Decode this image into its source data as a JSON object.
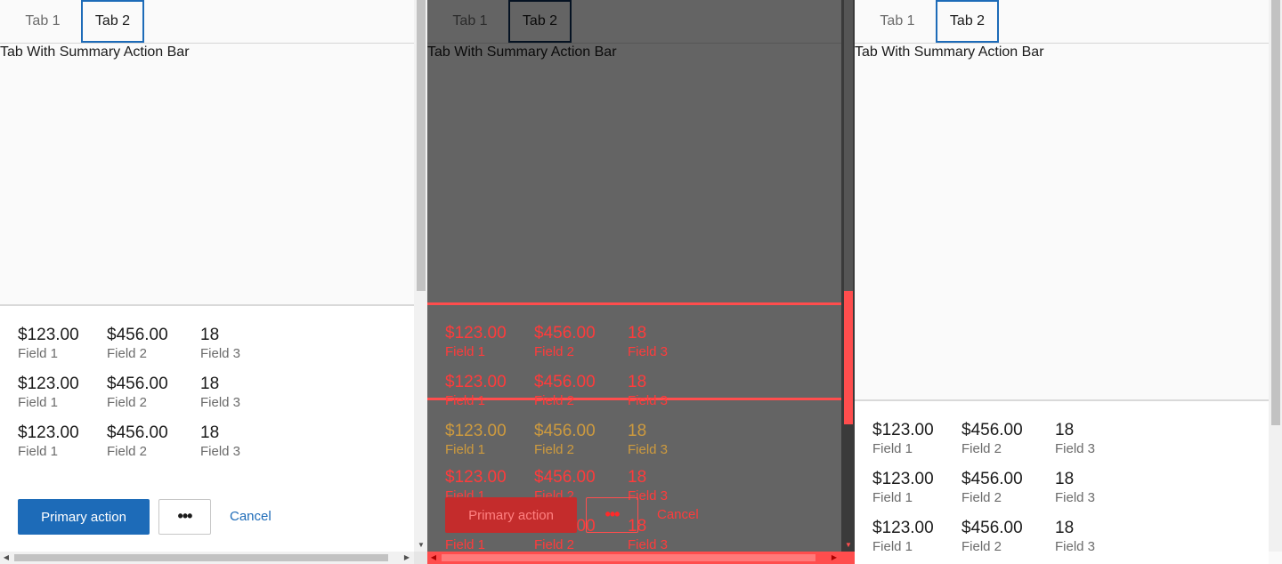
{
  "tabs": [
    {
      "label": "Tab 1"
    },
    {
      "label": "Tab 2"
    }
  ],
  "heading": "Tab With Summary Action Bar",
  "summary": {
    "rows": [
      {
        "field1_value": "$123.00",
        "field1_label": "Field 1",
        "field2_value": "$456.00",
        "field2_label": "Field 2",
        "field3_value": "18",
        "field3_label": "Field 3"
      },
      {
        "field1_value": "$123.00",
        "field1_label": "Field 1",
        "field2_value": "$456.00",
        "field2_label": "Field 2",
        "field3_value": "18",
        "field3_label": "Field 3"
      },
      {
        "field1_value": "$123.00",
        "field1_label": "Field 1",
        "field2_value": "$456.00",
        "field2_label": "Field 2",
        "field3_value": "18",
        "field3_label": "Field 3"
      }
    ]
  },
  "actions": {
    "primary_label": "Primary action",
    "more_label": "•••",
    "cancel_label": "Cancel"
  },
  "scroll": {
    "up_arrow": "▲",
    "down_arrow": "▼",
    "left_arrow": "◀",
    "right_arrow": "▶"
  },
  "colors": {
    "accent": "#1d6bb8",
    "highlight": "#ff4d4d",
    "overlay": "rgba(0,0,0,0.6)"
  }
}
